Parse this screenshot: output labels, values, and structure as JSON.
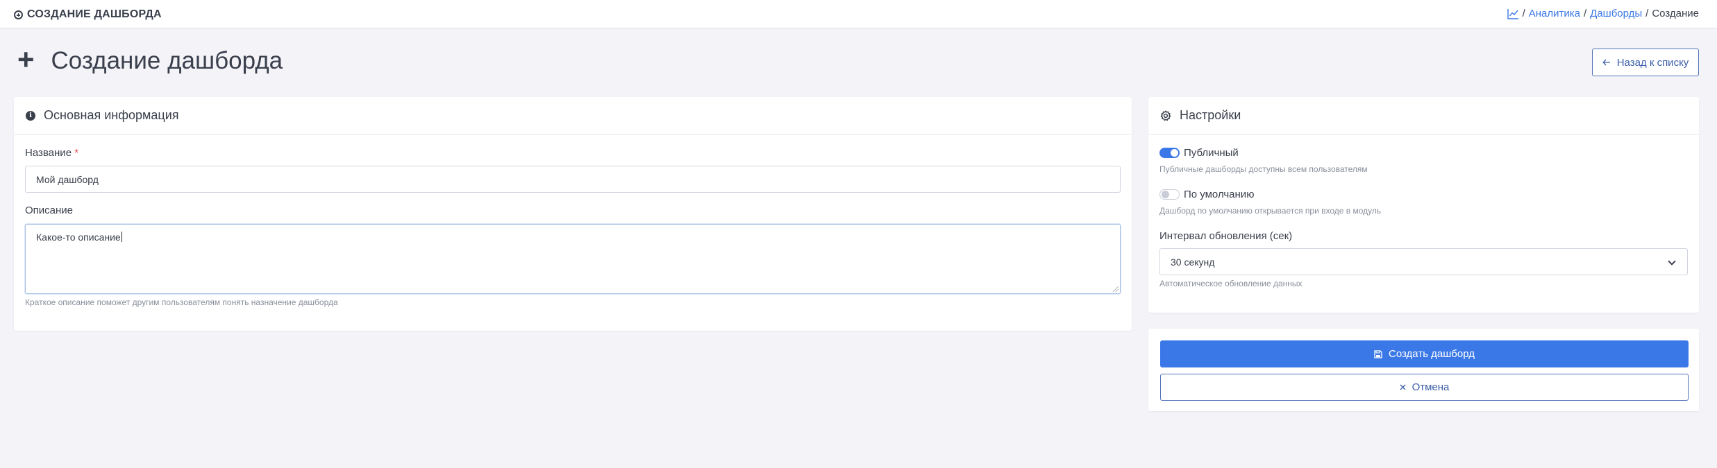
{
  "topbar": {
    "title": "СОЗДАНИЕ ДАШБОРДА",
    "icon": "circle-plus-icon"
  },
  "breadcrumb": {
    "icon": "chart-line-icon",
    "separator": "/",
    "items": [
      "Аналитика",
      "Дашборды"
    ],
    "current": "Создание"
  },
  "page": {
    "title": "Создание дашборда",
    "title_icon": "plus-icon",
    "back_button": "Назад к списку",
    "back_icon": "arrow-left-icon"
  },
  "basic_info": {
    "header": "Основная информация",
    "header_icon": "info-icon",
    "name_label": "Название",
    "required_mark": "*",
    "name_value": "Мой дашборд",
    "description_label": "Описание",
    "description_value": "Какое-то описание",
    "description_help": "Краткое описание поможет другим пользователям понять назначение дашборда"
  },
  "settings": {
    "header": "Настройки",
    "header_icon": "gear-icon",
    "public_label": "Публичный",
    "public_on": true,
    "public_help": "Публичные дашборды доступны всем пользователям",
    "default_label": "По умолчанию",
    "default_on": false,
    "default_help": "Дашборд по умолчанию открывается при входе в модуль",
    "interval_label": "Интервал обновления (сек)",
    "interval_value": "30 секунд",
    "interval_help": "Автоматическое обновление данных"
  },
  "actions": {
    "create_label": "Создать дашборд",
    "create_icon": "save-icon",
    "cancel_label": "Отмена",
    "cancel_icon": "close-icon"
  },
  "colors": {
    "accent": "#3b78e7",
    "background": "#f3f3f8",
    "text": "#3a3f4c",
    "required": "#e24b4b"
  }
}
